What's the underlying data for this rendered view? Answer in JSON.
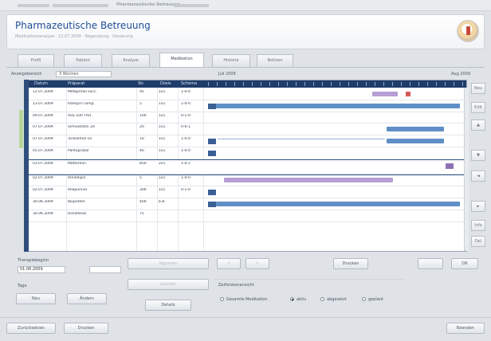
{
  "window": {
    "title": "Pharmazeutische Betreuung"
  },
  "header": {
    "title": "Pharmazeutische Betreuung",
    "subtitle": "Medikationsanalyse  ·  12.07.2009  ·  Regensburg  ·  Dosierung",
    "logo_icon": "pharmacy-logo-icon"
  },
  "tabs": [
    {
      "label": "Profil"
    },
    {
      "label": "Patient"
    },
    {
      "label": "Analyse"
    },
    {
      "label": "Medikation"
    },
    {
      "label": "Historie"
    },
    {
      "label": "Notizen"
    }
  ],
  "filter": {
    "label": "Anzeigebereich",
    "value": "3 Wochen"
  },
  "range_label": "Juli 2009",
  "range_label_right": "Aug 2009",
  "grid": {
    "columns": [
      "Datum",
      "Präparat",
      "Str.",
      "Dosis",
      "Schema"
    ],
    "rows": [
      {
        "date": "12.07.2009",
        "name": "Metoprolol succ.",
        "strength": "95",
        "dose": "1x1",
        "schema": "1-0-0"
      },
      {
        "date": "13.07.2009",
        "name": "Ramipril comp.",
        "strength": "5",
        "dose": "1x1",
        "schema": "1-0-0"
      },
      {
        "date": "09.07.2009",
        "name": "ASS 100 TAH",
        "strength": "100",
        "dose": "1x1",
        "schema": "0-1-0"
      },
      {
        "date": "07.07.2009",
        "name": "Simvastatin 20",
        "strength": "20",
        "dose": "1x1",
        "schema": "0-0-1"
      },
      {
        "date": "07.07.2009",
        "name": "Torasemid 10",
        "strength": "10",
        "dose": "1x1",
        "schema": "1-0-0"
      },
      {
        "date": "05.07.2009",
        "name": "Pantoprazol",
        "strength": "40",
        "dose": "1x1",
        "schema": "1-0-0"
      },
      {
        "date": "03.07.2009",
        "name": "Metformin",
        "strength": "850",
        "dose": "2x1",
        "schema": "1-0-1"
      },
      {
        "date": "02.07.2009",
        "name": "Amlodipin",
        "strength": "5",
        "dose": "1x1",
        "schema": "1-0-0"
      },
      {
        "date": "02.07.2009",
        "name": "Allopurinol",
        "strength": "300",
        "dose": "1x1",
        "schema": "0-1-0"
      },
      {
        "date": "30.06.2009",
        "name": "Ibuprofen",
        "strength": "400",
        "dose": "b.B.",
        "schema": ""
      },
      {
        "date": "30.06.2009",
        "name": "Diclofenac",
        "strength": "75",
        "dose": "",
        "schema": ""
      }
    ]
  },
  "bottom": {
    "date_label": "Therapiebeginn",
    "date_value": "01.06.2009",
    "unit_label": "Tage",
    "btn_new": "Neu",
    "btn_edit": "Ändern",
    "btn_copy": "Kopieren",
    "btn_delete": "Löschen",
    "btn_details": "Details",
    "btn_prev": "<",
    "btn_next": ">",
    "btn_print": "Drucken",
    "btn_ok": "OK",
    "view_label": "Zeitleistenansicht",
    "radio_options": [
      "Gesamte Medikation",
      "aktiv",
      "abgesetzt",
      "geplant"
    ]
  },
  "statusbar": {
    "btn_left": "Zurücksetzen",
    "btn_mid": "Drucken",
    "btn_right": "Beenden"
  },
  "side_buttons": [
    "Neu",
    "Edit",
    "▲",
    "▼",
    "◄",
    "►",
    "Info",
    "Del"
  ]
}
